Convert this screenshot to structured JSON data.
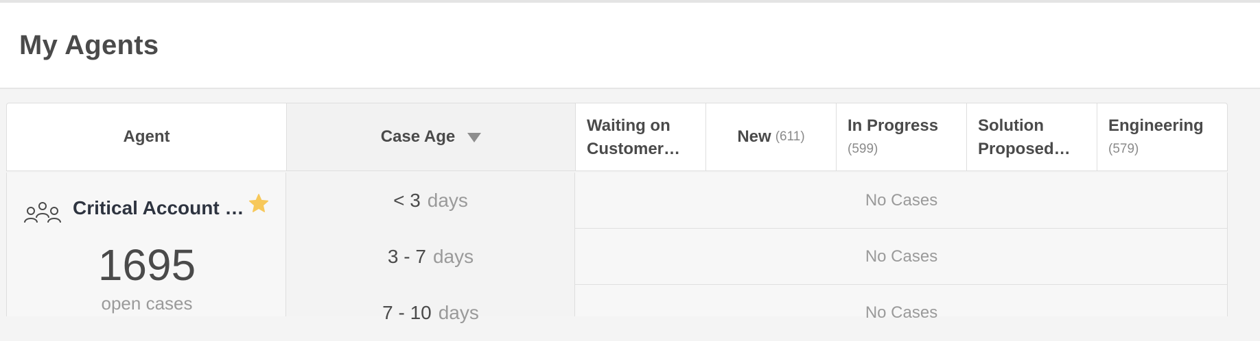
{
  "header": {
    "title": "My Agents"
  },
  "table": {
    "columns": {
      "agent": "Agent",
      "case_age": "Case Age",
      "statuses": [
        {
          "label_line1": "Waiting on",
          "label_line2": "Customer…",
          "count": ""
        },
        {
          "label": "New",
          "count": "(611)"
        },
        {
          "label": "In Progress",
          "count": "(599)"
        },
        {
          "label_line1": "Solution",
          "label_line2": "Proposed…",
          "count": ""
        },
        {
          "label": "Engineering",
          "count": "(579)"
        }
      ]
    },
    "rows": [
      {
        "agent_name": "Critical Account …",
        "open_count": "1695",
        "open_label": "open cases",
        "favorite": true,
        "age_buckets": [
          {
            "range": "< 3",
            "unit": "days",
            "cases": "No Cases"
          },
          {
            "range": "3 - 7",
            "unit": "days",
            "cases": "No Cases"
          },
          {
            "range": "7 - 10",
            "unit": "days",
            "cases": "No Cases"
          }
        ]
      }
    ]
  },
  "colors": {
    "star": "#f7c85a",
    "accent_text": "#4a4a4a",
    "muted_text": "#9a9a9a"
  },
  "icons": {
    "agent_group": "group-icon",
    "favorite": "star-icon",
    "sort": "sort-descending-icon"
  }
}
